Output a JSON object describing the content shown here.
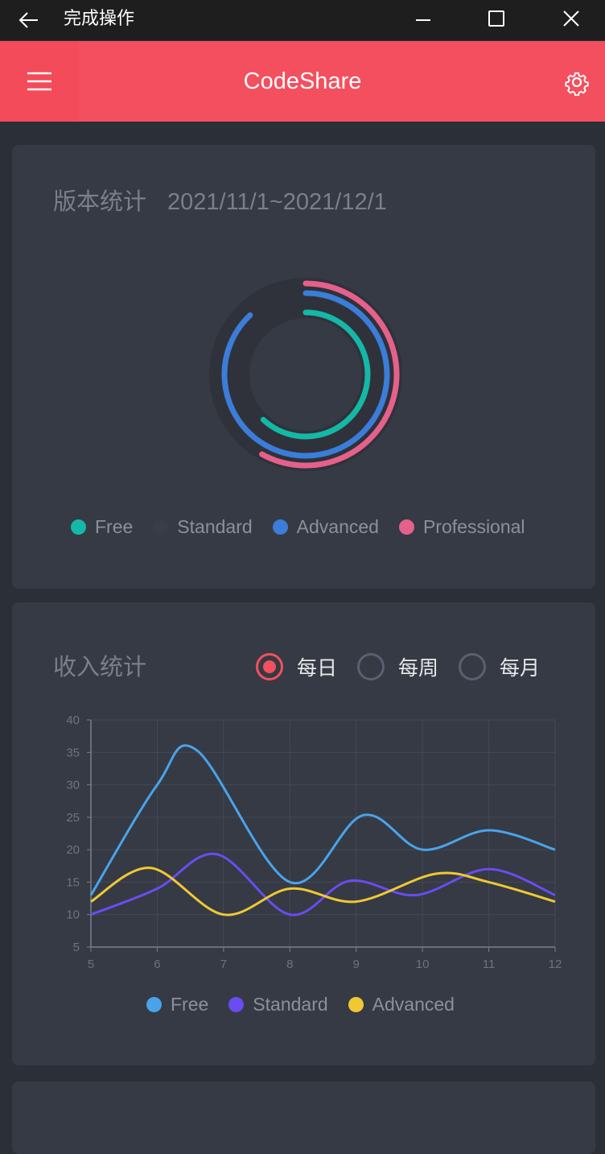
{
  "window": {
    "title": "完成操作"
  },
  "app": {
    "title": "CodeShare"
  },
  "version_card": {
    "title": "版本统计",
    "date_range": "2021/11/1~2021/12/1",
    "legend": [
      {
        "label": "Free",
        "color": "#14b8a6"
      },
      {
        "label": "Standard",
        "color": "#3a3d44"
      },
      {
        "label": "Advanced",
        "color": "#3b7dd8"
      },
      {
        "label": "Professional",
        "color": "#e5608a"
      }
    ]
  },
  "income_card": {
    "title": "收入统计",
    "periods": [
      {
        "label": "每日",
        "selected": true
      },
      {
        "label": "每周",
        "selected": false
      },
      {
        "label": "每月",
        "selected": false
      }
    ]
  },
  "chart_data": [
    {
      "type": "pie",
      "subtype": "radial-rings",
      "categories": [
        "Free",
        "Standard",
        "Advanced",
        "Professional"
      ],
      "values": [
        0.62,
        0.0,
        0.88,
        0.58
      ],
      "colors": [
        "#14b8a6",
        "#3a3d44",
        "#3b7dd8",
        "#e5608a"
      ],
      "legend": "bottom"
    },
    {
      "type": "line",
      "x": [
        5,
        6,
        7,
        8,
        9,
        10,
        11,
        12
      ],
      "xlim": [
        5,
        12
      ],
      "ylim": [
        5,
        40
      ],
      "yticks": [
        5,
        10,
        15,
        20,
        25,
        30,
        35,
        40
      ],
      "grid": true,
      "legend": "bottom",
      "series": [
        {
          "name": "Free",
          "color": "#4aa3ea",
          "points": [
            [
              5,
              13
            ],
            [
              6,
              30
            ],
            [
              6.6,
              35.3
            ],
            [
              8,
              15
            ],
            [
              9.1,
              25.3
            ],
            [
              10,
              20
            ],
            [
              11,
              23
            ],
            [
              12,
              20
            ]
          ]
        },
        {
          "name": "Standard",
          "color": "#6a4cf0",
          "points": [
            [
              5,
              10
            ],
            [
              6,
              14
            ],
            [
              6.9,
              19.3
            ],
            [
              8,
              10
            ],
            [
              8.9,
              15.2
            ],
            [
              9.9,
              13
            ],
            [
              11,
              17
            ],
            [
              12,
              13
            ]
          ]
        },
        {
          "name": "Advanced",
          "color": "#f0c832",
          "points": [
            [
              5,
              12
            ],
            [
              5.9,
              17.2
            ],
            [
              7,
              10
            ],
            [
              8,
              14
            ],
            [
              9,
              12
            ],
            [
              10.2,
              16.3
            ],
            [
              11,
              15
            ],
            [
              12,
              12
            ]
          ]
        }
      ]
    }
  ]
}
